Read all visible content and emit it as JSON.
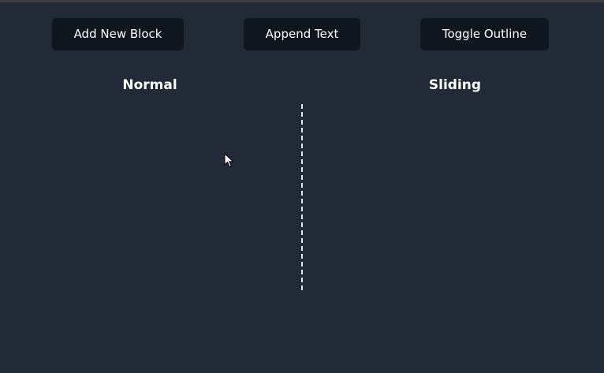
{
  "toolbar": {
    "add_label": "Add New Block",
    "append_label": "Append Text",
    "toggle_label": "Toggle Outline"
  },
  "panels": {
    "left_title": "Normal",
    "right_title": "Sliding"
  },
  "colors": {
    "background": "#212a36",
    "button_bg": "#0f161e",
    "text": "#ffffff",
    "divider": "#e8e8e8"
  }
}
